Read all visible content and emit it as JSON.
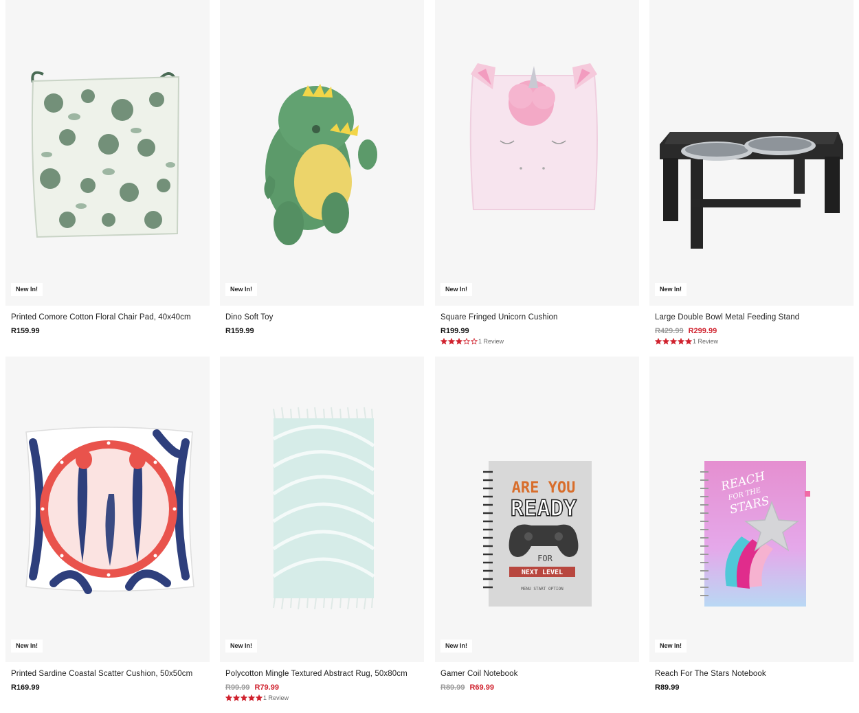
{
  "products": [
    {
      "name": "Printed Comore Cotton Floral Chair Pad, 40x40cm",
      "badge": "New In!",
      "price": "R159.99",
      "was": "",
      "now": "",
      "stars": 0,
      "review": "",
      "image": "floral-chair-pad"
    },
    {
      "name": "Dino Soft Toy",
      "badge": "New In!",
      "price": "R159.99",
      "was": "",
      "now": "",
      "stars": 0,
      "review": "",
      "image": "dino-plush"
    },
    {
      "name": "Square Fringed Unicorn Cushion",
      "badge": "New In!",
      "price": "R199.99",
      "was": "",
      "now": "",
      "stars": 3,
      "review": "1 Review",
      "image": "unicorn-cushion"
    },
    {
      "name": "Large Double Bowl Metal Feeding Stand",
      "badge": "New In!",
      "price": "",
      "was": "R429.99",
      "now": "R299.99",
      "stars": 5,
      "review": "1 Review",
      "image": "feeding-stand"
    },
    {
      "name": "Printed Sardine Coastal Scatter Cushion, 50x50cm",
      "badge": "New In!",
      "price": "R169.99",
      "was": "",
      "now": "",
      "stars": 0,
      "review": "",
      "image": "sardine-cushion"
    },
    {
      "name": "Polycotton Mingle Textured Abstract Rug, 50x80cm",
      "badge": "New In!",
      "price": "",
      "was": "R99.99",
      "now": "R79.99",
      "stars": 5,
      "review": "1 Review",
      "image": "textured-rug"
    },
    {
      "name": "Gamer Coil Notebook",
      "badge": "New In!",
      "price": "",
      "was": "R89.99",
      "now": "R69.99",
      "stars": 0,
      "review": "",
      "image": "gamer-notebook"
    },
    {
      "name": "Reach For The Stars Notebook",
      "badge": "New In!",
      "price": "R89.99",
      "was": "",
      "now": "",
      "stars": 0,
      "review": "",
      "image": "stars-notebook"
    }
  ],
  "art": {
    "gamer": {
      "line1": "ARE YOU",
      "line2": "READY",
      "line3": "FOR",
      "line4": "NEXT LEVEL",
      "line5": "MENU START OPTION"
    },
    "stars": {
      "line1": "REACH",
      "line2": "FOR THE",
      "line3": "STARS"
    }
  },
  "colors": {
    "sale": "#d0222e",
    "star": "#d0222e",
    "card_bg": "#f6f6f6"
  }
}
